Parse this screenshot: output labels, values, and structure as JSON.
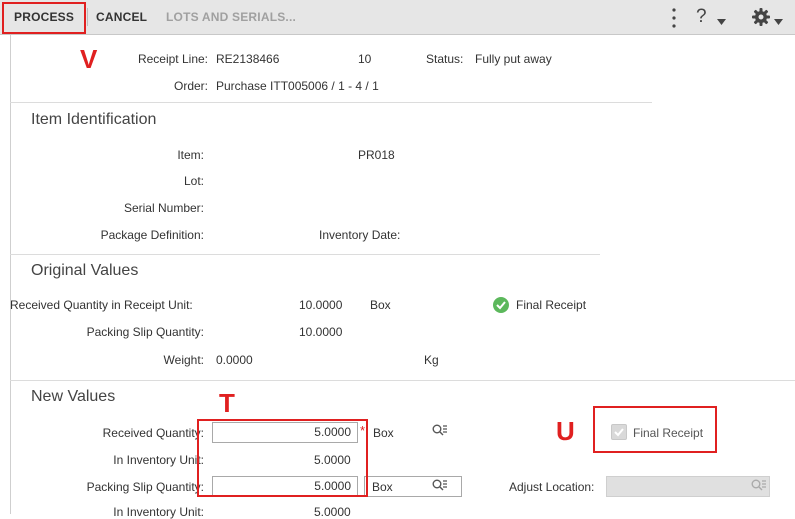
{
  "toolbar": {
    "process": "PROCESS",
    "cancel": "CANCEL",
    "lots_serials": "LOTS AND SERIALS...",
    "help_glyph": "?",
    "more_icon": "more-vertical-icon",
    "help_icon": "help-icon",
    "settings_icon": "gear-icon"
  },
  "annotations": {
    "v": "V",
    "t": "T",
    "u": "U"
  },
  "header": {
    "receipt_line_label": "Receipt Line:",
    "receipt_line_value": "RE2138466",
    "line_number": "10",
    "status_label": "Status:",
    "status_value": "Fully put away",
    "order_label": "Order:",
    "order_value": "Purchase ITT005006 / 1 - 4 / 1"
  },
  "item_identification": {
    "title": "Item Identification",
    "item_label": "Item:",
    "item_value": "PR018",
    "lot_label": "Lot:",
    "serial_label": "Serial Number:",
    "package_label": "Package Definition:",
    "inventory_date_label": "Inventory Date:"
  },
  "original_values": {
    "title": "Original Values",
    "received_qty_label": "Received Quantity in Receipt Unit:",
    "received_qty_value": "10.0000",
    "received_unit": "Box",
    "final_receipt_label": "Final Receipt",
    "packing_slip_label": "Packing Slip Quantity:",
    "packing_slip_value": "10.0000",
    "weight_label": "Weight:",
    "weight_value": "0.0000",
    "weight_unit": "Kg"
  },
  "new_values": {
    "title": "New Values",
    "received_qty_label": "Received Quantity:",
    "received_qty_value": "5.0000",
    "required_marker": "*",
    "received_unit": "Box",
    "in_inventory_label_1": "In Inventory Unit:",
    "in_inventory_value_1": "5.0000",
    "packing_slip_label": "Packing Slip Quantity:",
    "packing_slip_value": "5.0000",
    "packing_unit": "Box",
    "final_receipt_label": "Final Receipt",
    "final_receipt_checked": true,
    "adjust_location_label": "Adjust Location:",
    "adjust_location_value": "",
    "in_inventory_label_2": "In Inventory Unit:",
    "in_inventory_value_2": "5.0000"
  },
  "colors": {
    "annotation_red": "#e02020",
    "check_green": "#5cb85c",
    "toolbar_bg": "#e6e6e6"
  }
}
